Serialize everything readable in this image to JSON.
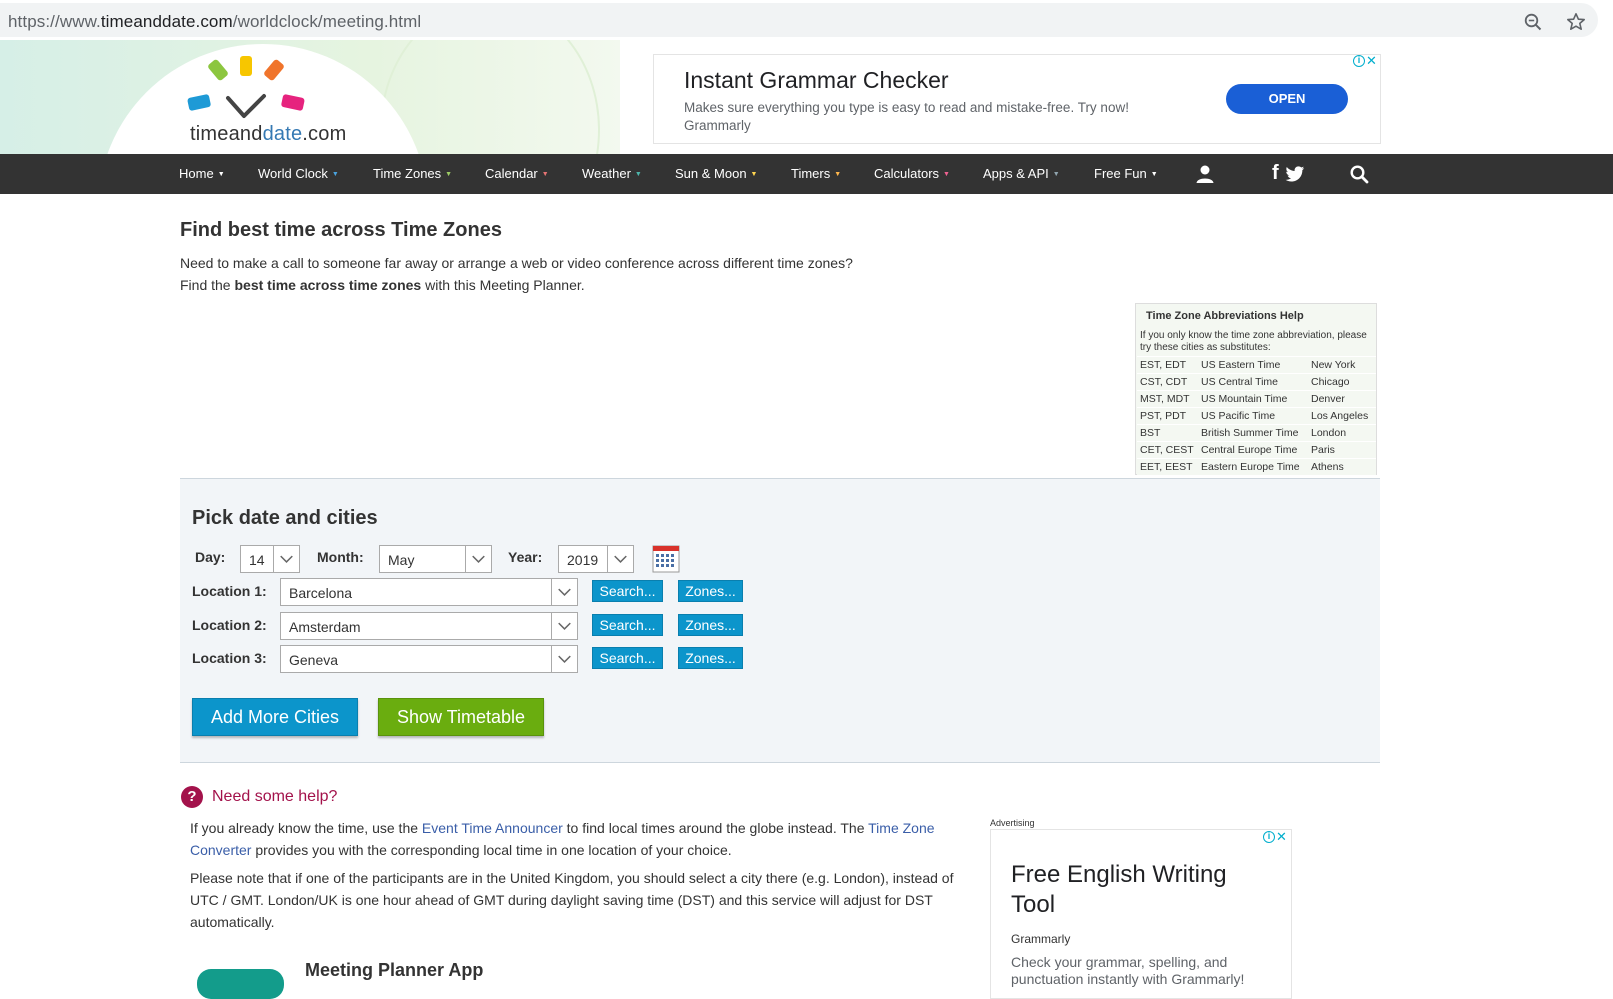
{
  "browser": {
    "url_prefix": "https://www.",
    "url_domain": "timeanddate.com",
    "url_path": "/worldclock/meeting.html"
  },
  "logo": {
    "text_a": "timeand",
    "text_b": "date",
    "text_c": ".com"
  },
  "top_ad": {
    "title": "Instant Grammar Checker",
    "description": "Makes sure everything you type is easy to read and mistake-free. Try now!",
    "brand": "Grammarly",
    "button": "OPEN"
  },
  "nav": {
    "items": [
      "Home",
      "World Clock",
      "Time Zones",
      "Calendar",
      "Weather",
      "Sun & Moon",
      "Timers",
      "Calculators",
      "Apps & API",
      "Free Fun"
    ],
    "icons": [
      "user-icon",
      "facebook-icon",
      "twitter-icon",
      "search-icon"
    ],
    "social_f": "f"
  },
  "intro": {
    "title": "Find best time across Time Zones",
    "line1": "Need to make a call to someone far away or arrange a web or video conference across different time zones?",
    "line2_a": "Find the ",
    "line2_b": "best time across time zones",
    "line2_c": " with this Meeting Planner."
  },
  "tz_help": {
    "title": "Time Zone Abbreviations Help",
    "note": "If you only know the time zone abbreviation, please try these cities as substitutes:",
    "rows": [
      {
        "abbr": "EST, EDT",
        "name": "US Eastern Time",
        "city": "New York"
      },
      {
        "abbr": "CST, CDT",
        "name": "US Central Time",
        "city": "Chicago"
      },
      {
        "abbr": "MST, MDT",
        "name": "US Mountain Time",
        "city": "Denver"
      },
      {
        "abbr": "PST, PDT",
        "name": "US Pacific Time",
        "city": "Los Angeles"
      },
      {
        "abbr": "BST",
        "name": "British Summer Time",
        "city": "London"
      },
      {
        "abbr": "CET, CEST",
        "name": "Central Europe Time",
        "city": "Paris"
      },
      {
        "abbr": "EET, EEST",
        "name": "Eastern Europe Time",
        "city": "Athens"
      }
    ]
  },
  "pick": {
    "title": "Pick date and cities",
    "day_label": "Day:",
    "day_value": "14",
    "month_label": "Month:",
    "month_value": "May",
    "year_label": "Year:",
    "year_value": "2019",
    "locations": [
      {
        "label": "Location 1:",
        "value": "Barcelona"
      },
      {
        "label": "Location 2:",
        "value": "Amsterdam"
      },
      {
        "label": "Location 3:",
        "value": "Geneva"
      }
    ],
    "search_label": "Search...",
    "zones_label": "Zones...",
    "add_more": "Add More Cities",
    "show_timetable": "Show Timetable"
  },
  "help": {
    "icon_glyph": "?",
    "title": "Need some help?",
    "p1_a": "If you already know the time, use the ",
    "p1_link1": "Event Time Announcer",
    "p1_b": " to find local times around the globe instead. The ",
    "p1_link2": "Time Zone Converter",
    "p1_c": " provides you with the corresponding local time in one location of your choice.",
    "p2": "Please note that if one of the participants are in the United Kingdom, you should select a city there (e.g. London), instead of UTC / GMT. London/UK is one hour ahead of GMT during daylight saving time (DST) and this service will adjust for DST automatically.",
    "app_title": "Meeting Planner App"
  },
  "right_ad": {
    "label": "Advertising",
    "title": "Free English Writing Tool",
    "brand": "Grammarly",
    "description": "Check your grammar, spelling, and punctuation instantly with Grammarly!"
  },
  "colors": {
    "nav_bg": "#333333",
    "button_blue": "#0c95cb",
    "button_green": "#6aad0f",
    "help_accent": "#a3124b",
    "link": "#3a5ea8"
  }
}
